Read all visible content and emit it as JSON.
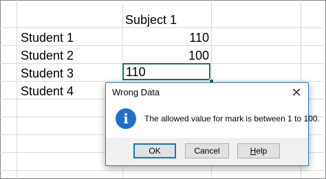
{
  "sheet": {
    "header": {
      "subject": "Subject 1"
    },
    "rows": [
      {
        "label": "Student 1",
        "value": "110"
      },
      {
        "label": "Student 2",
        "value": "100"
      },
      {
        "label": "Student 3",
        "value": "110"
      },
      {
        "label": "Student 4",
        "value": ""
      }
    ],
    "accent_color": "#217346"
  },
  "dialog": {
    "title": "Wrong Data",
    "close_glyph": "✕",
    "icon": "info-icon",
    "icon_glyph": "i",
    "message": "The allowed value for mark is between 1 to 100.",
    "buttons": {
      "ok": "OK",
      "cancel": "Cancel",
      "help_first": "H",
      "help_rest": "elp"
    },
    "accent_color": "#1f6fcb"
  }
}
